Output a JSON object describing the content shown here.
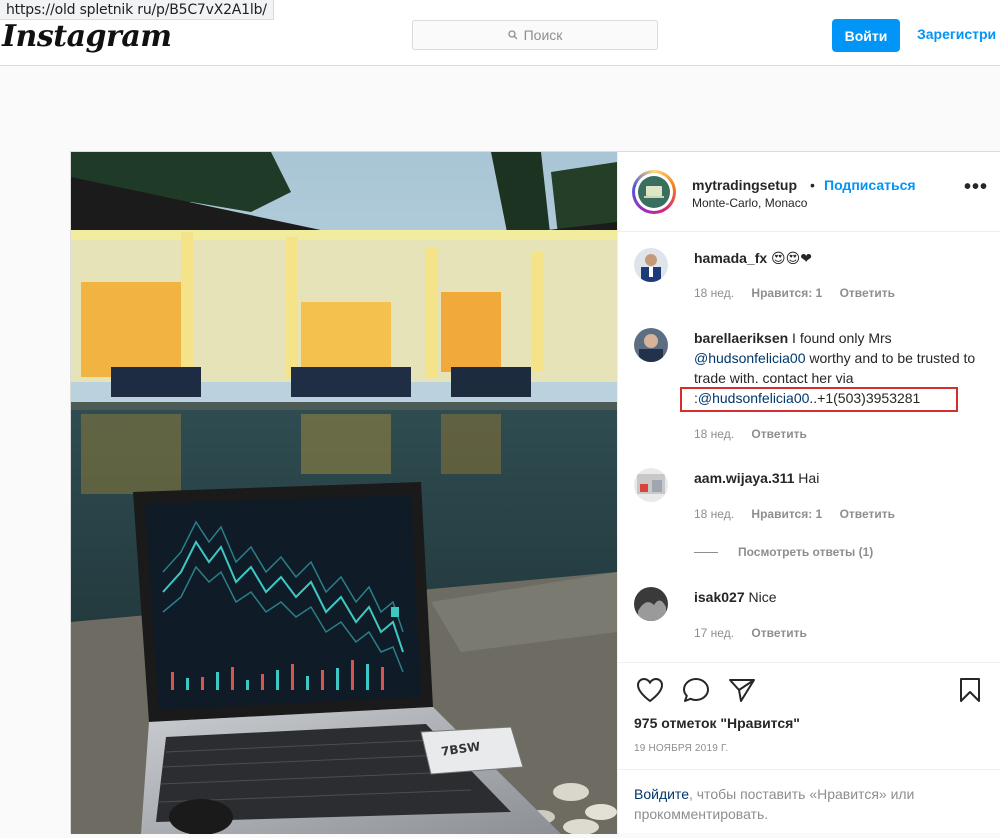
{
  "browser": {
    "url": "https://old spletnik ru/p/B5C7vX2A1lb/"
  },
  "header": {
    "logo": "Instagram",
    "search_placeholder": "Поиск",
    "login_label": "Войти",
    "signup_label": "Зарегистри"
  },
  "post": {
    "author": "mytradingsetup",
    "dot": "•",
    "follow_label": "Подписаться",
    "location": "Monte-Carlo, Monaco",
    "more": "•••",
    "photo_sticker": "7BSW",
    "comments": [
      {
        "user": "hamada_fx",
        "text": "😍😍❤",
        "age": "18 нед.",
        "likes": "Нравится: 1",
        "reply": "Ответить"
      },
      {
        "user": "barellaeriksen",
        "text_1": " I found only Mrs ",
        "mention_1": "@hudsonfelicia00",
        "text_2": " worthy and to be trusted to trade with. contact her via ",
        "mention_2": ":@hudsonfelicia00",
        "text_3": "..+1(503)3953281",
        "age": "18 нед.",
        "reply": "Ответить"
      },
      {
        "user": "aam.wijaya.311",
        "text": " Hai",
        "age": "18 нед.",
        "likes": "Нравится: 1",
        "reply": "Ответить",
        "view_replies": "Посмотреть ответы (1)"
      },
      {
        "user": "isak027",
        "text": " Nice",
        "age": "17 нед.",
        "reply": "Ответить"
      }
    ],
    "likes_count": "975 отметок \"Нравится\"",
    "date": "19 НОЯБРЯ 2019 Г.",
    "login_prompt_link": "Войдите",
    "login_prompt_text": ", чтобы поставить «Нравится» или прокомментировать."
  },
  "colors": {
    "accent": "#0095f6",
    "highlight_box": "#d32f2f"
  }
}
